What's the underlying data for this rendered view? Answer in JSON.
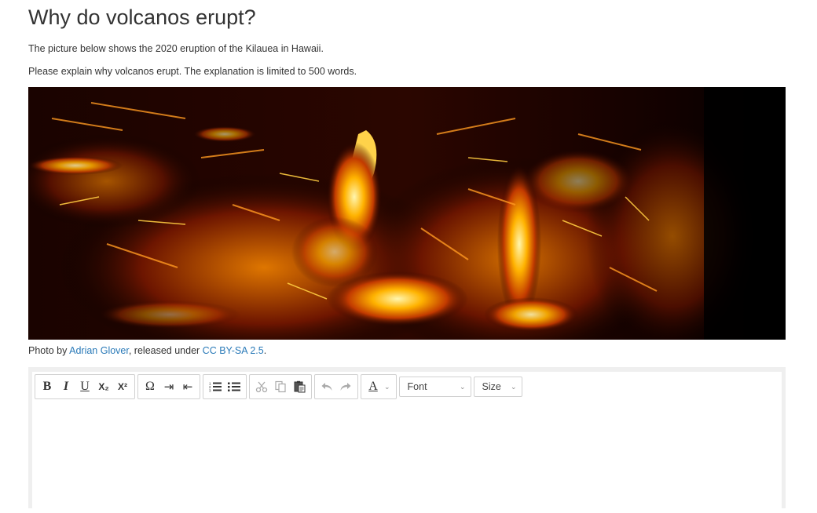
{
  "page": {
    "title": "Why do volcanos erupt?",
    "paragraph1": "The picture below shows the 2020 eruption of the Kilauea in Hawaii.",
    "paragraph2": "Please explain why volcanos erupt. The explanation is limited to 500 words."
  },
  "credit": {
    "prefix": "Photo by ",
    "author": "Adrian Glover",
    "middle": ", released under ",
    "license": "CC BY-SA 2.5",
    "suffix": "."
  },
  "toolbar": {
    "bold": "B",
    "italic": "I",
    "underline": "U",
    "subscript": "X₂",
    "superscript": "X²",
    "special_char": "Ω",
    "indent": "⇥",
    "outdent": "⇤",
    "font_label": "Font",
    "size_label": "Size",
    "text_color": "A"
  },
  "colors": {
    "link": "#2a7ab8",
    "text": "#333333",
    "border": "#d1d1d1"
  }
}
